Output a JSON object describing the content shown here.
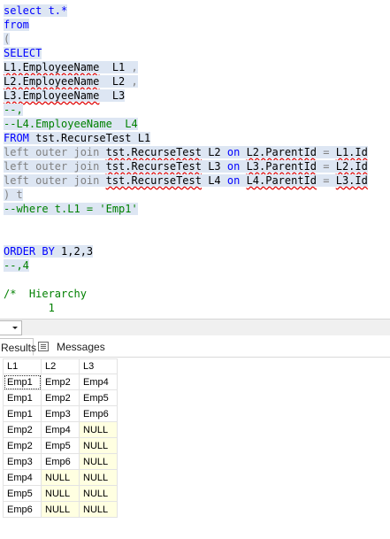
{
  "editor": {
    "lines": [
      {
        "segs": [
          {
            "t": "select t.*",
            "c": "kw"
          }
        ]
      },
      {
        "segs": [
          {
            "t": "from",
            "c": "kw"
          }
        ]
      },
      {
        "segs": [
          {
            "t": "(",
            "c": "gr"
          }
        ]
      },
      {
        "segs": [
          {
            "t": "SELECT",
            "c": "kw"
          }
        ]
      },
      {
        "segs": [
          {
            "t": "L1.EmployeeName",
            "c": "sq"
          },
          {
            "t": "  L1 ",
            "c": ""
          },
          {
            "t": ",",
            "c": "gr"
          }
        ]
      },
      {
        "segs": [
          {
            "t": "L2.EmployeeName",
            "c": "sq"
          },
          {
            "t": "  L2 ",
            "c": ""
          },
          {
            "t": ",",
            "c": "gr"
          }
        ]
      },
      {
        "segs": [
          {
            "t": "L3.EmployeeName",
            "c": "sq"
          },
          {
            "t": "  L3",
            "c": ""
          }
        ]
      },
      {
        "segs": [
          {
            "t": "--,",
            "c": "cm"
          }
        ]
      },
      {
        "segs": [
          {
            "t": "--L4.EmployeeName  L4",
            "c": "cm"
          }
        ]
      },
      {
        "segs": [
          {
            "t": "FROM ",
            "c": "kw"
          },
          {
            "t": "tst.RecurseTest L1",
            "c": ""
          }
        ]
      },
      {
        "segs": [
          {
            "t": "left outer join ",
            "c": "gr"
          },
          {
            "t": "tst.RecurseTest",
            "c": "sq"
          },
          {
            "t": " L2 ",
            "c": ""
          },
          {
            "t": "on ",
            "c": "kw"
          },
          {
            "t": "L2.ParentId",
            "c": "sq"
          },
          {
            "t": " = ",
            "c": "gr"
          },
          {
            "t": "L1.Id",
            "c": "sq"
          }
        ]
      },
      {
        "segs": [
          {
            "t": "left outer join ",
            "c": "gr"
          },
          {
            "t": "tst.RecurseTest",
            "c": "sq"
          },
          {
            "t": " L3 ",
            "c": ""
          },
          {
            "t": "on ",
            "c": "kw"
          },
          {
            "t": "L3.ParentId",
            "c": "sq"
          },
          {
            "t": " = ",
            "c": "gr"
          },
          {
            "t": "L2.Id",
            "c": "sq"
          }
        ]
      },
      {
        "segs": [
          {
            "t": "left outer join ",
            "c": "gr"
          },
          {
            "t": "tst.RecurseTest",
            "c": "sq"
          },
          {
            "t": " L4 ",
            "c": ""
          },
          {
            "t": "on ",
            "c": "kw"
          },
          {
            "t": "L4.ParentId",
            "c": "sq"
          },
          {
            "t": " = ",
            "c": "gr"
          },
          {
            "t": "L3.Id",
            "c": "sq"
          }
        ]
      },
      {
        "segs": [
          {
            "t": ") t",
            "c": "gr"
          }
        ]
      },
      {
        "segs": [
          {
            "t": "--where t.L1 = 'Emp1'",
            "c": "cm"
          }
        ]
      },
      {
        "segs": [
          {
            "t": "",
            "c": ""
          }
        ]
      },
      {
        "segs": [
          {
            "t": "",
            "c": ""
          }
        ]
      },
      {
        "segs": [
          {
            "t": "ORDER BY ",
            "c": "kw"
          },
          {
            "t": "1,2,3",
            "c": ""
          }
        ]
      },
      {
        "segs": [
          {
            "t": "--,4",
            "c": "cm"
          }
        ]
      },
      {
        "segs": [
          {
            "t": "",
            "c": ""
          }
        ]
      },
      {
        "segs": [
          {
            "t": "/*  Hierarchy",
            "c": "cm"
          }
        ]
      },
      {
        "segs": [
          {
            "t": "       1",
            "c": "cm"
          }
        ]
      }
    ]
  },
  "tabs": {
    "results_label": "Results",
    "messages_label": "Messages"
  },
  "grid": {
    "columns": [
      "L1",
      "L2",
      "L3"
    ],
    "rows": [
      [
        "Emp1",
        "Emp2",
        "Emp4"
      ],
      [
        "Emp1",
        "Emp2",
        "Emp5"
      ],
      [
        "Emp1",
        "Emp3",
        "Emp6"
      ],
      [
        "Emp2",
        "Emp4",
        "NULL"
      ],
      [
        "Emp2",
        "Emp5",
        "NULL"
      ],
      [
        "Emp3",
        "Emp6",
        "NULL"
      ],
      [
        "Emp4",
        "NULL",
        "NULL"
      ],
      [
        "Emp5",
        "NULL",
        "NULL"
      ],
      [
        "Emp6",
        "NULL",
        "NULL"
      ]
    ]
  }
}
